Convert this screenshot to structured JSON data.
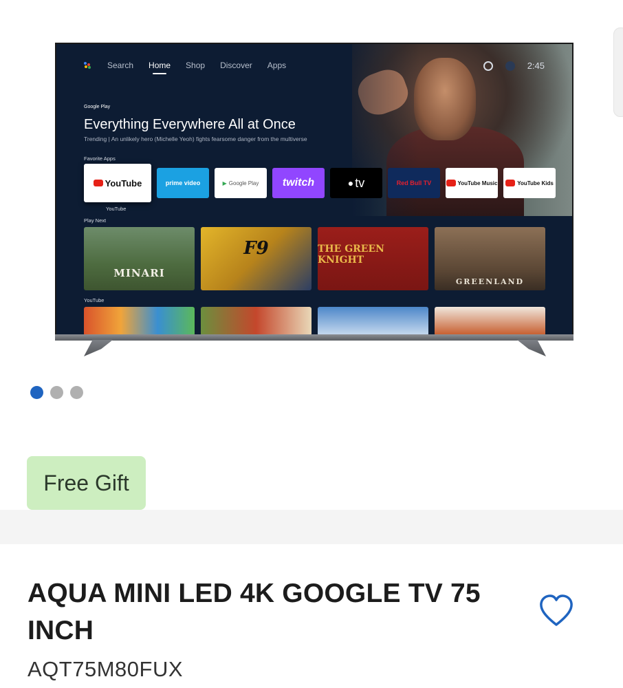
{
  "tv_screen": {
    "nav": {
      "search": "Search",
      "home": "Home",
      "shop": "Shop",
      "discover": "Discover",
      "apps": "Apps"
    },
    "clock": "2:45",
    "brand": "Google Play",
    "feature_title": "Everything Everywhere All at Once",
    "feature_subtitle": "Trending | An unlikely hero (Michelle Yeoh) fights fearsome danger from the multiverse",
    "favorite_apps_label": "Favorite Apps",
    "apps": [
      {
        "label": "YouTube",
        "icon": "youtube-icon"
      },
      {
        "label": "prime video",
        "icon": "prime-video-icon"
      },
      {
        "label": "Google Play",
        "icon": "google-play-icon"
      },
      {
        "label": "twitch",
        "icon": "twitch-icon"
      },
      {
        "label": "tv",
        "icon": "apple-icon"
      },
      {
        "label": "Red Bull TV",
        "icon": "red-bull-icon"
      },
      {
        "label": "YouTube Music",
        "icon": "youtube-music-icon"
      },
      {
        "label": "YouTube Kids",
        "icon": "youtube-kids-icon"
      }
    ],
    "focused_app_caption": "YouTube",
    "play_next_label": "Play Next",
    "play_next": [
      "MINARI",
      "F9",
      "THE GREEN KNIGHT",
      "GREENLAND"
    ],
    "youtube_row_label": "YouTube"
  },
  "carousel": {
    "total": 3,
    "active": 1
  },
  "badge": {
    "label": "Free Gift"
  },
  "product": {
    "title": "AQUA MINI LED 4K GOOGLE TV 75 INCH",
    "sku": "AQT75M80FUX"
  },
  "colors": {
    "accent": "#1f64c0",
    "badge_bg": "#cdeec0",
    "screen_bg": "#0d1c33"
  }
}
